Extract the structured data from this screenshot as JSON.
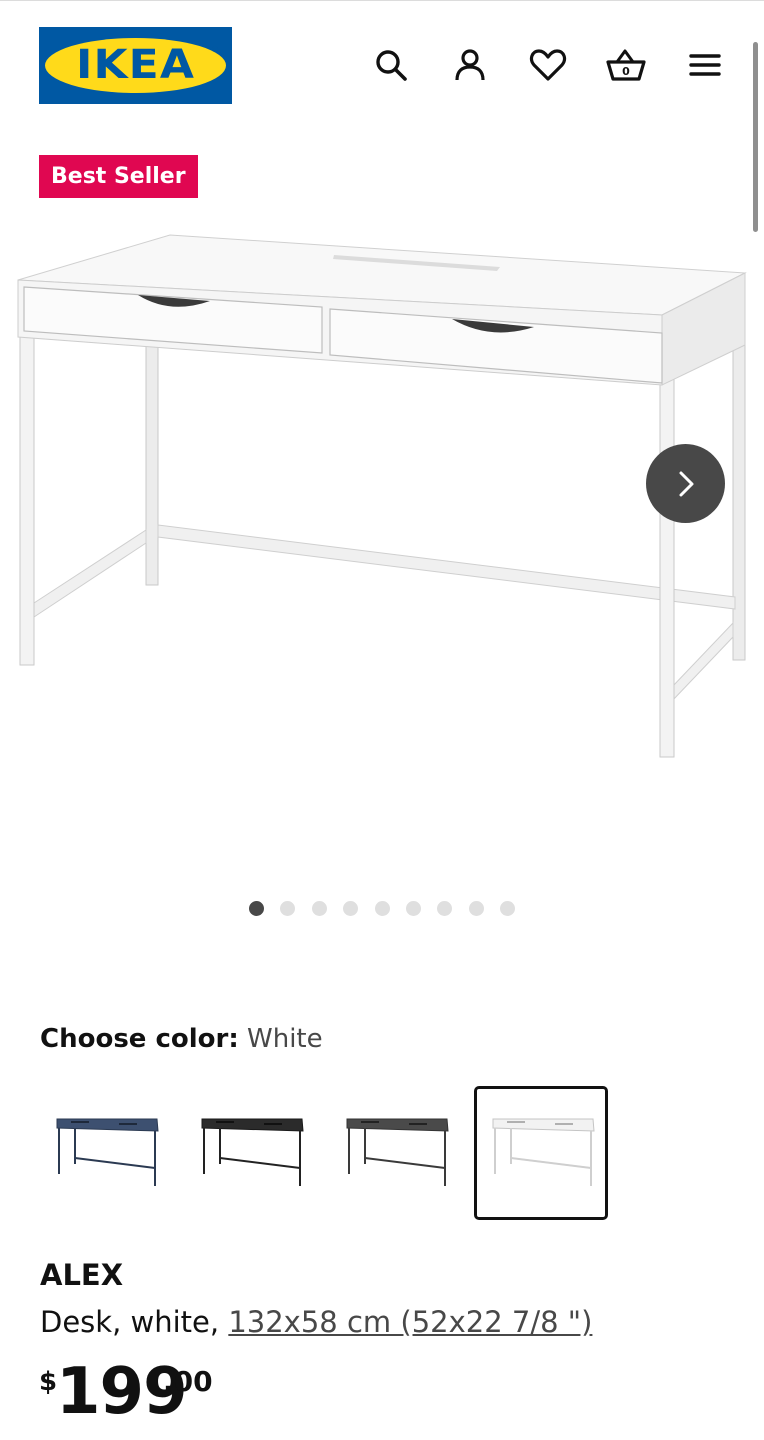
{
  "header": {
    "logo_text": "IKEA",
    "logo_registered": "®",
    "icons": [
      "search-icon",
      "account-icon",
      "heart-icon",
      "basket-icon",
      "menu-icon"
    ],
    "basket_count": "0"
  },
  "badge": {
    "label": "Best Seller",
    "color": "#e00751"
  },
  "gallery": {
    "image": "alex-desk-white",
    "total_images": 9,
    "active_index": 0
  },
  "color_picker": {
    "label": "Choose color:",
    "selected": "White",
    "options": [
      {
        "name": "blue",
        "color": "#3d5070"
      },
      {
        "name": "black",
        "color": "#2b2b2b"
      },
      {
        "name": "grey",
        "color": "#4a4a4a"
      },
      {
        "name": "white",
        "color": "#f2f2f2",
        "selected": true
      }
    ]
  },
  "product": {
    "name": "ALEX",
    "description": "Desk, white, ",
    "measurements": "132x58 cm (52x22 7/8 \")",
    "price_currency": "$",
    "price_integer": "199",
    "price_decimal": ".00"
  },
  "colors": {
    "ikea_blue": "#0058a3",
    "ikea_yellow": "#ffda1a",
    "dark": "#111111",
    "button": "#484848"
  }
}
